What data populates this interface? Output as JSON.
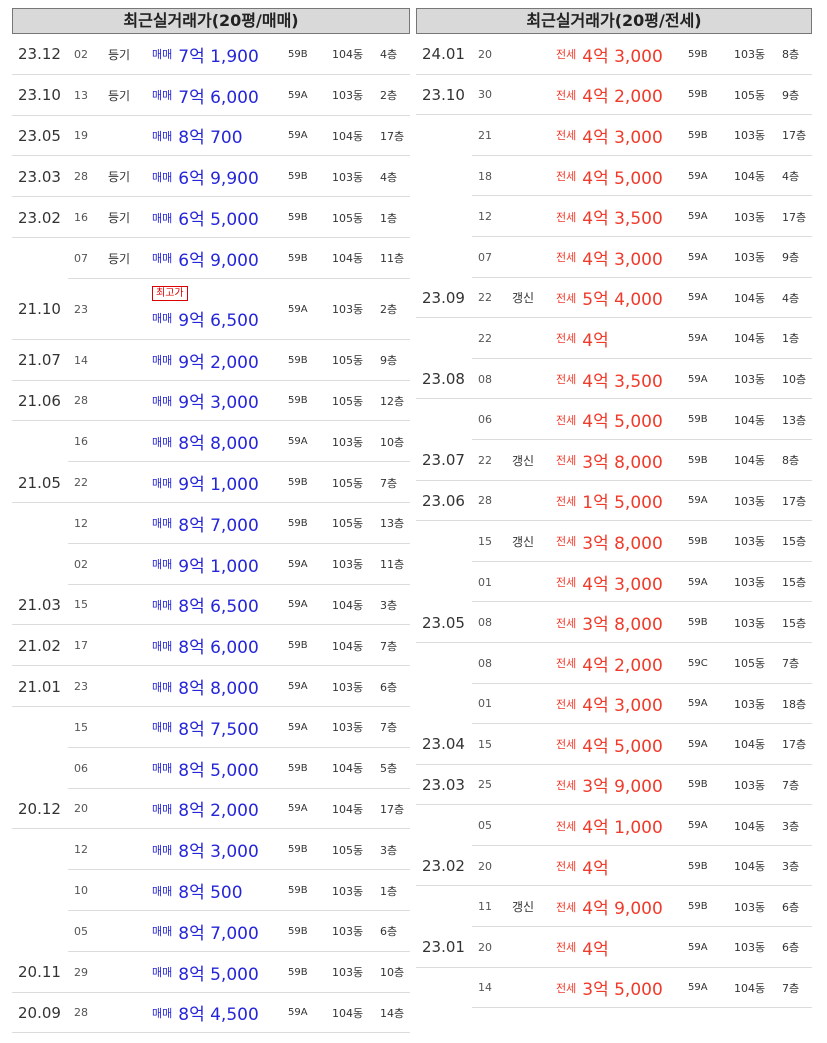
{
  "sale": {
    "title": "최근실거래가(20평/매매)",
    "rows": [
      {
        "ym": "23.12",
        "day": "02",
        "note": "등기",
        "type": "매매",
        "price": "7억 1,900",
        "size": "59B",
        "dong": "104동",
        "floor": "4층"
      },
      {
        "ym": "23.10",
        "day": "13",
        "note": "등기",
        "type": "매매",
        "price": "7억 6,000",
        "size": "59A",
        "dong": "103동",
        "floor": "2층"
      },
      {
        "ym": "23.05",
        "day": "19",
        "note": "",
        "type": "매매",
        "price": "8억 700",
        "size": "59A",
        "dong": "104동",
        "floor": "17층"
      },
      {
        "ym": "23.03",
        "day": "28",
        "note": "등기",
        "type": "매매",
        "price": "6억 9,900",
        "size": "59B",
        "dong": "103동",
        "floor": "4층"
      },
      {
        "ym": "23.02",
        "day": "16",
        "note": "등기",
        "type": "매매",
        "price": "6억 5,000",
        "size": "59B",
        "dong": "105동",
        "floor": "1층"
      },
      {
        "ym": "",
        "day": "07",
        "note": "등기",
        "type": "매매",
        "price": "6억 9,000",
        "size": "59B",
        "dong": "104동",
        "floor": "11층"
      },
      {
        "ym": "21.10",
        "day": "23",
        "note": "",
        "type": "매매",
        "price": "9억 6,500",
        "size": "59A",
        "dong": "103동",
        "floor": "2층",
        "badge": "최고가"
      },
      {
        "ym": "21.07",
        "day": "14",
        "note": "",
        "type": "매매",
        "price": "9억 2,000",
        "size": "59B",
        "dong": "105동",
        "floor": "9층"
      },
      {
        "ym": "21.06",
        "day": "28",
        "note": "",
        "type": "매매",
        "price": "9억 3,000",
        "size": "59B",
        "dong": "105동",
        "floor": "12층"
      },
      {
        "ym": "",
        "day": "16",
        "note": "",
        "type": "매매",
        "price": "8억 8,000",
        "size": "59A",
        "dong": "103동",
        "floor": "10층"
      },
      {
        "ym": "21.05",
        "day": "22",
        "note": "",
        "type": "매매",
        "price": "9억 1,000",
        "size": "59B",
        "dong": "105동",
        "floor": "7층"
      },
      {
        "ym": "",
        "day": "12",
        "note": "",
        "type": "매매",
        "price": "8억 7,000",
        "size": "59B",
        "dong": "105동",
        "floor": "13층"
      },
      {
        "ym": "",
        "day": "02",
        "note": "",
        "type": "매매",
        "price": "9억 1,000",
        "size": "59A",
        "dong": "103동",
        "floor": "11층"
      },
      {
        "ym": "21.03",
        "day": "15",
        "note": "",
        "type": "매매",
        "price": "8억 6,500",
        "size": "59A",
        "dong": "104동",
        "floor": "3층"
      },
      {
        "ym": "21.02",
        "day": "17",
        "note": "",
        "type": "매매",
        "price": "8억 6,000",
        "size": "59B",
        "dong": "104동",
        "floor": "7층"
      },
      {
        "ym": "21.01",
        "day": "23",
        "note": "",
        "type": "매매",
        "price": "8억 8,000",
        "size": "59A",
        "dong": "103동",
        "floor": "6층"
      },
      {
        "ym": "",
        "day": "15",
        "note": "",
        "type": "매매",
        "price": "8억 7,500",
        "size": "59A",
        "dong": "103동",
        "floor": "7층"
      },
      {
        "ym": "",
        "day": "06",
        "note": "",
        "type": "매매",
        "price": "8억 5,000",
        "size": "59B",
        "dong": "104동",
        "floor": "5층"
      },
      {
        "ym": "20.12",
        "day": "20",
        "note": "",
        "type": "매매",
        "price": "8억 2,000",
        "size": "59A",
        "dong": "104동",
        "floor": "17층"
      },
      {
        "ym": "",
        "day": "12",
        "note": "",
        "type": "매매",
        "price": "8억 3,000",
        "size": "59B",
        "dong": "105동",
        "floor": "3층"
      },
      {
        "ym": "",
        "day": "10",
        "note": "",
        "type": "매매",
        "price": "8억 500",
        "size": "59B",
        "dong": "103동",
        "floor": "1층"
      },
      {
        "ym": "",
        "day": "05",
        "note": "",
        "type": "매매",
        "price": "8억 7,000",
        "size": "59B",
        "dong": "103동",
        "floor": "6층"
      },
      {
        "ym": "20.11",
        "day": "29",
        "note": "",
        "type": "매매",
        "price": "8억 5,000",
        "size": "59B",
        "dong": "103동",
        "floor": "10층"
      },
      {
        "ym": "20.09",
        "day": "28",
        "note": "",
        "type": "매매",
        "price": "8억 4,500",
        "size": "59A",
        "dong": "104동",
        "floor": "14층"
      }
    ]
  },
  "lease": {
    "title": "최근실거래가(20평/전세)",
    "rows": [
      {
        "ym": "24.01",
        "day": "20",
        "note": "",
        "type": "전세",
        "price": "4억 3,000",
        "size": "59B",
        "dong": "103동",
        "floor": "8층"
      },
      {
        "ym": "23.10",
        "day": "30",
        "note": "",
        "type": "전세",
        "price": "4억 2,000",
        "size": "59B",
        "dong": "105동",
        "floor": "9층"
      },
      {
        "ym": "",
        "day": "21",
        "note": "",
        "type": "전세",
        "price": "4억 3,000",
        "size": "59B",
        "dong": "103동",
        "floor": "17층"
      },
      {
        "ym": "",
        "day": "18",
        "note": "",
        "type": "전세",
        "price": "4억 5,000",
        "size": "59A",
        "dong": "104동",
        "floor": "4층"
      },
      {
        "ym": "",
        "day": "12",
        "note": "",
        "type": "전세",
        "price": "4억 3,500",
        "size": "59A",
        "dong": "103동",
        "floor": "17층"
      },
      {
        "ym": "",
        "day": "07",
        "note": "",
        "type": "전세",
        "price": "4억 3,000",
        "size": "59A",
        "dong": "103동",
        "floor": "9층"
      },
      {
        "ym": "23.09",
        "day": "22",
        "note": "갱신",
        "type": "전세",
        "price": "5억 4,000",
        "size": "59A",
        "dong": "104동",
        "floor": "4층"
      },
      {
        "ym": "",
        "day": "22",
        "note": "",
        "type": "전세",
        "price": "4억",
        "size": "59A",
        "dong": "104동",
        "floor": "1층"
      },
      {
        "ym": "23.08",
        "day": "08",
        "note": "",
        "type": "전세",
        "price": "4억 3,500",
        "size": "59A",
        "dong": "103동",
        "floor": "10층"
      },
      {
        "ym": "",
        "day": "06",
        "note": "",
        "type": "전세",
        "price": "4억 5,000",
        "size": "59B",
        "dong": "104동",
        "floor": "13층"
      },
      {
        "ym": "23.07",
        "day": "22",
        "note": "갱신",
        "type": "전세",
        "price": "3억 8,000",
        "size": "59B",
        "dong": "104동",
        "floor": "8층"
      },
      {
        "ym": "23.06",
        "day": "28",
        "note": "",
        "type": "전세",
        "price": "1억 5,000",
        "size": "59A",
        "dong": "103동",
        "floor": "17층"
      },
      {
        "ym": "",
        "day": "15",
        "note": "갱신",
        "type": "전세",
        "price": "3억 8,000",
        "size": "59B",
        "dong": "103동",
        "floor": "15층"
      },
      {
        "ym": "",
        "day": "01",
        "note": "",
        "type": "전세",
        "price": "4억 3,000",
        "size": "59A",
        "dong": "103동",
        "floor": "15층"
      },
      {
        "ym": "23.05",
        "day": "08",
        "note": "",
        "type": "전세",
        "price": "3억 8,000",
        "size": "59B",
        "dong": "103동",
        "floor": "15층"
      },
      {
        "ym": "",
        "day": "08",
        "note": "",
        "type": "전세",
        "price": "4억 2,000",
        "size": "59C",
        "dong": "105동",
        "floor": "7층"
      },
      {
        "ym": "",
        "day": "01",
        "note": "",
        "type": "전세",
        "price": "4억 3,000",
        "size": "59A",
        "dong": "103동",
        "floor": "18층"
      },
      {
        "ym": "23.04",
        "day": "15",
        "note": "",
        "type": "전세",
        "price": "4억 5,000",
        "size": "59A",
        "dong": "104동",
        "floor": "17층"
      },
      {
        "ym": "23.03",
        "day": "25",
        "note": "",
        "type": "전세",
        "price": "3억 9,000",
        "size": "59B",
        "dong": "103동",
        "floor": "7층"
      },
      {
        "ym": "",
        "day": "05",
        "note": "",
        "type": "전세",
        "price": "4억 1,000",
        "size": "59A",
        "dong": "104동",
        "floor": "3층"
      },
      {
        "ym": "23.02",
        "day": "20",
        "note": "",
        "type": "전세",
        "price": "4억",
        "size": "59B",
        "dong": "104동",
        "floor": "3층"
      },
      {
        "ym": "",
        "day": "11",
        "note": "갱신",
        "type": "전세",
        "price": "4억 9,000",
        "size": "59B",
        "dong": "103동",
        "floor": "6층"
      },
      {
        "ym": "23.01",
        "day": "20",
        "note": "",
        "type": "전세",
        "price": "4억",
        "size": "59A",
        "dong": "103동",
        "floor": "6층"
      },
      {
        "ym": "",
        "day": "14",
        "note": "",
        "type": "전세",
        "price": "3억 5,000",
        "size": "59A",
        "dong": "104동",
        "floor": "7층"
      }
    ]
  },
  "colors": {
    "sale": "#2626d9",
    "lease": "#f03a2a",
    "header_bg": "#d9d9d9"
  }
}
